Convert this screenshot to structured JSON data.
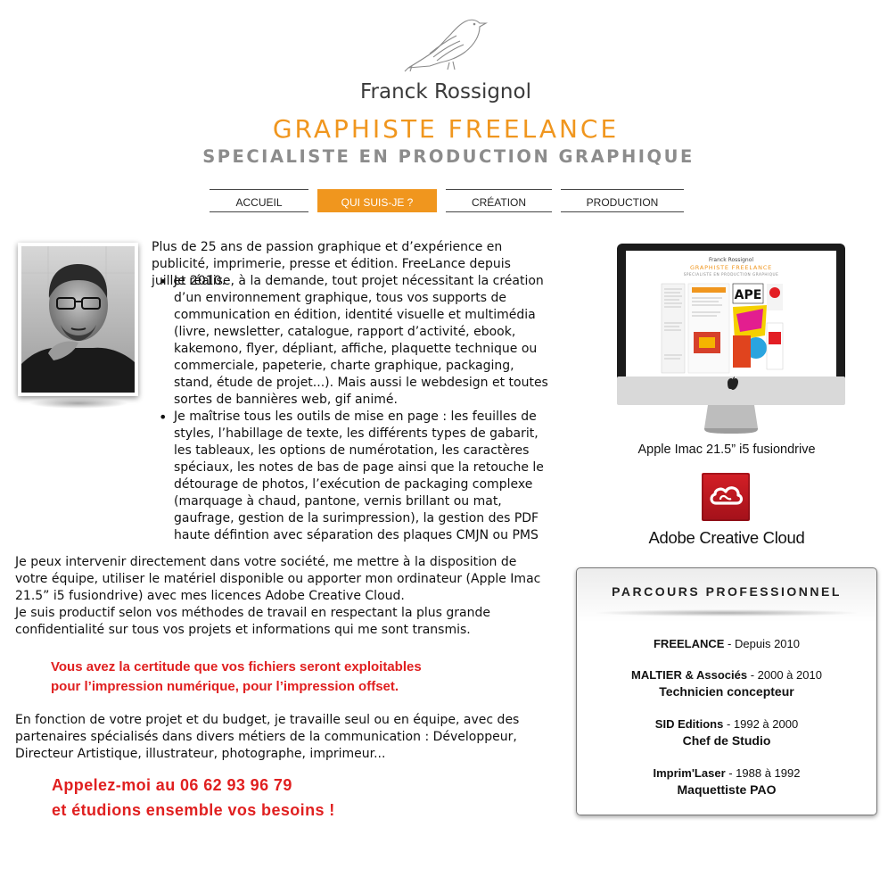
{
  "header": {
    "name": "Franck Rossignol",
    "title": "GRAPHISTE FREELANCE",
    "subtitle": "SPECIALISTE EN PRODUCTION GRAPHIQUE"
  },
  "nav": {
    "items": [
      {
        "label": "ACCUEIL"
      },
      {
        "label": "QUI SUIS-JE ?",
        "active": true
      },
      {
        "label": "CRÉATION"
      },
      {
        "label": "PRODUCTION"
      }
    ]
  },
  "main": {
    "intro": "Plus de 25 ans de passion graphique et d’expérience en publicité, imprimerie, presse et édition. FreeLance depuis juillet 2010.",
    "bullets": [
      "Je réalise, à la demande, tout projet nécessitant la création d’un environnement graphique, tous vos supports de communication en édition, identité visuelle et multimédia (livre, newsletter, catalogue, rapport d’activité, ebook, kakemono, flyer, dépliant, affiche, plaquette technique ou commerciale, papeterie, charte graphique, packaging, stand, étude de projet...). Mais aussi le webdesign et toutes sortes de bannières web, gif animé.",
      "Je maîtrise tous les outils de mise en page : les feuilles de styles, l’habillage de texte, les différents types de gabarit, les tableaux, les options de numérotation, les caractères spéciaux, les notes de bas de page ainsi que la retouche le détourage de photos, l’exécution de packaging complexe (marquage à chaud, pantone, vernis brillant ou mat, gaufrage, gestion de la surimpression), la gestion des PDF haute défintion avec séparation des plaques CMJN ou PMS"
    ],
    "para1": "Je peux intervenir directement dans votre société, me mettre à la disposition de votre équipe, utiliser le matériel disponible ou apporter mon ordinateur (Apple Imac 21.5” i5 fusiondrive) avec mes licences Adobe Creative Cloud.",
    "para1b": "Je suis productif selon vos méthodes de travail en respectant la plus grande confidentialité sur tous vos projets et informations qui me sont transmis.",
    "red_line1": "Vous avez la certitude que vos fichiers seront exploitables",
    "red_line2": "pour l’impression numérique, pour l’impression offset.",
    "para2": "En fonction de votre projet et du budget, je travaille seul ou en équipe, avec des partenaires spécialisés dans divers métiers de la communication : Développeur, Directeur Artistique, illustrateur, photographe, imprimeur...",
    "cta_line1": "Appelez-moi au 06 62 93 96 79",
    "cta_line2": "et étudions ensemble vos besoins !"
  },
  "sidebar": {
    "imac_caption": "Apple Imac 21.5” i5 fusiondrive",
    "imac_screen": {
      "name": "Franck Rossignol",
      "title": "GRAPHISTE FREELANCE",
      "subtitle": "SPECIALISTE EN PRODUCTION GRAPHIQUE",
      "ape": "APE"
    },
    "acc_label": "Adobe Creative Cloud",
    "parcours": {
      "title": "PARCOURS PROFESSIONNEL",
      "jobs": [
        {
          "company": "FREELANCE",
          "period": " - Depuis 2010",
          "role": ""
        },
        {
          "company": "MALTIER & Associés",
          "period": " - 2000 à 2010",
          "role": "Technicien concepteur"
        },
        {
          "company": "SID Editions",
          "period": " - 1992 à 2000",
          "role": "Chef de Studio"
        },
        {
          "company": "Imprim'Laser",
          "period": " - 1988 à 1992",
          "role": "Maquettiste PAO"
        }
      ]
    }
  },
  "icons": [
    "bird-logo-icon",
    "adobe-creative-cloud-icon",
    "apple-logo-icon"
  ],
  "colors": {
    "accent": "#f0961e",
    "red": "#e01f1f",
    "subtitle_gray": "#8c8c8c"
  }
}
